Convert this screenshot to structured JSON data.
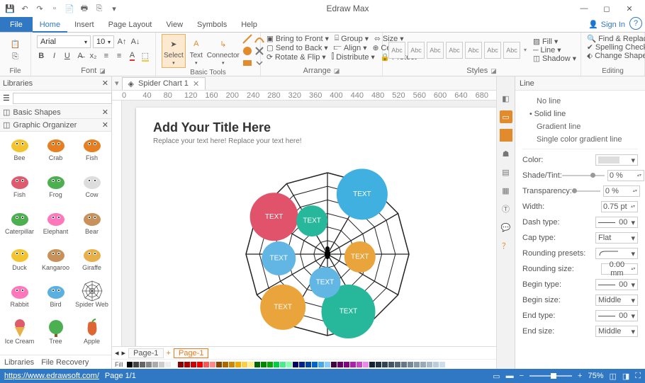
{
  "app": {
    "title": "Edraw Max"
  },
  "qat": [
    "save",
    "undo",
    "redo",
    "new",
    "open",
    "print",
    "export",
    "preview"
  ],
  "window": {
    "signin": "Sign In"
  },
  "tabs": {
    "file": "File",
    "items": [
      "Home",
      "Insert",
      "Page Layout",
      "View",
      "Symbols",
      "Help"
    ],
    "active": 0
  },
  "ribbon": {
    "file_group": "File",
    "font_group": "Font",
    "font_name": "Arial",
    "font_size": "10",
    "basic_tools": "Basic Tools",
    "select": "Select",
    "text": "Text",
    "connector": "Connector",
    "arrange": "Arrange",
    "bring_front": "Bring to Front",
    "send_back": "Send to Back",
    "rotate_flip": "Rotate & Flip",
    "group": "Group",
    "align": "Align",
    "distribute": "Distribute",
    "size": "Size",
    "center": "Center",
    "protect": "Protect",
    "styles": "Styles",
    "style_text": "Abc",
    "fill": "Fill",
    "line": "Line",
    "shadow": "Shadow",
    "editing": "Editing",
    "find_replace": "Find & Replace",
    "spelling": "Spelling Check",
    "change_shape": "Change Shape"
  },
  "libraries": {
    "title": "Libraries",
    "search_placeholder": "",
    "sections": [
      {
        "title": "Basic Shapes"
      },
      {
        "title": "Graphic Organizer"
      }
    ],
    "shapes": [
      {
        "name": "Bee",
        "svg": "bee"
      },
      {
        "name": "Crab",
        "svg": "crab"
      },
      {
        "name": "Fish",
        "svg": "fish1"
      },
      {
        "name": "Fish",
        "svg": "fish2"
      },
      {
        "name": "Frog",
        "svg": "frog"
      },
      {
        "name": "Cow",
        "svg": "cow"
      },
      {
        "name": "Caterpillar",
        "svg": "caterpillar"
      },
      {
        "name": "Elephant",
        "svg": "elephant"
      },
      {
        "name": "Bear",
        "svg": "bear"
      },
      {
        "name": "Duck",
        "svg": "duck"
      },
      {
        "name": "Kangaroo",
        "svg": "kangaroo"
      },
      {
        "name": "Giraffe",
        "svg": "giraffe"
      },
      {
        "name": "Rabbit",
        "svg": "rabbit"
      },
      {
        "name": "Bird",
        "svg": "bird"
      },
      {
        "name": "Spider Web",
        "svg": "web"
      },
      {
        "name": "Ice Cream",
        "svg": "icecream"
      },
      {
        "name": "Tree",
        "svg": "tree"
      },
      {
        "name": "Apple",
        "svg": "apple"
      }
    ],
    "footer": [
      "Libraries",
      "File Recovery"
    ]
  },
  "doc": {
    "tab": "Spider Chart 1",
    "ruler_marks": [
      "0",
      "40",
      "80",
      "120",
      "160",
      "200",
      "240",
      "280",
      "320",
      "360",
      "400",
      "440",
      "480",
      "520",
      "560",
      "600",
      "640",
      "680"
    ],
    "title": "Add Your Title Here",
    "sub": "Replace your text here!   Replace your text here!",
    "bubble_text": "TEXT",
    "pages": [
      "Page-1",
      "Page-1"
    ],
    "fill_label": "Fill"
  },
  "line_panel": {
    "title": "Line",
    "options": [
      "No line",
      "Solid line",
      "Gradient line",
      "Single color gradient line"
    ],
    "active_option": 1,
    "color": "Color:",
    "shade": "Shade/Tint:",
    "shade_val": "0 %",
    "transparency": "Transparency:",
    "transparency_val": "0 %",
    "width": "Width:",
    "width_val": "0.75 pt",
    "dash": "Dash type:",
    "dash_val": "00",
    "cap": "Cap type:",
    "cap_val": "Flat",
    "rounding_presets": "Rounding presets:",
    "rounding_size": "Rounding size:",
    "rounding_size_val": "0.00 mm",
    "begin_type": "Begin type:",
    "begin_type_val": "00",
    "begin_size": "Begin size:",
    "begin_size_val": "Middle",
    "end_type": "End type:",
    "end_type_val": "00",
    "end_size": "End size:",
    "end_size_val": "Middle"
  },
  "status": {
    "url": "https://www.edrawsoft.com/",
    "page": "Page 1/1",
    "zoom": "75%"
  },
  "chart_data": {
    "type": "radar",
    "title": "Add Your Title Here",
    "rings": 6,
    "spokes": 12,
    "series": [
      {
        "name": "TEXT",
        "color": "#3fb0e0",
        "angle": 30,
        "radius": 0.85,
        "size": 36
      },
      {
        "name": "TEXT",
        "color": "#e9a43b",
        "angle": 95,
        "radius": 0.4,
        "size": 22
      },
      {
        "name": "TEXT",
        "color": "#27b89b",
        "angle": 160,
        "radius": 0.75,
        "size": 38
      },
      {
        "name": "TEXT",
        "color": "#62b6e4",
        "angle": 185,
        "radius": 0.35,
        "size": 22
      },
      {
        "name": "TEXT",
        "color": "#e9a43b",
        "angle": 220,
        "radius": 0.85,
        "size": 32
      },
      {
        "name": "TEXT",
        "color": "#62b6e4",
        "angle": 265,
        "radius": 0.6,
        "size": 24
      },
      {
        "name": "TEXT",
        "color": "#e0536a",
        "angle": 305,
        "radius": 0.8,
        "size": 34
      },
      {
        "name": "TEXT",
        "color": "#27b89b",
        "angle": 335,
        "radius": 0.45,
        "size": 22
      }
    ]
  }
}
